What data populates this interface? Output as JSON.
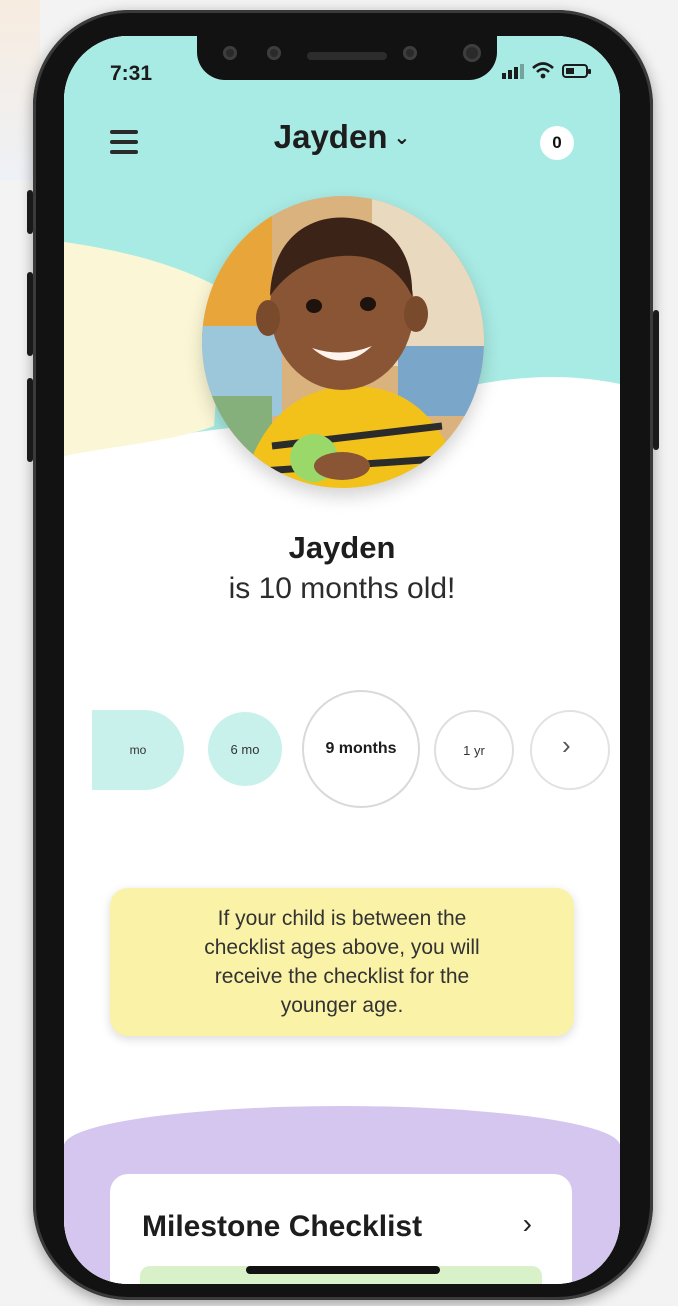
{
  "status_bar": {
    "time": "7:31"
  },
  "header": {
    "title": "Jayden",
    "notification_count": "0"
  },
  "child": {
    "name": "Jayden",
    "age_text": "is 10 months old!"
  },
  "age_selector": {
    "partial_left_label": "mo",
    "items": [
      "6 mo",
      "9 months",
      "1 yr"
    ],
    "selected": "9 months"
  },
  "info": {
    "message": "If your child is between the checklist ages above, you will receive the checklist for the younger age."
  },
  "milestone": {
    "title": "Milestone Checklist"
  },
  "colors": {
    "header_mint": "#a8ebe4",
    "wave_cream": "#fbf7d6",
    "chip_mint": "#c9f1ec",
    "info_yellow": "#faf3a7",
    "section_purple": "#d4c6ef"
  }
}
